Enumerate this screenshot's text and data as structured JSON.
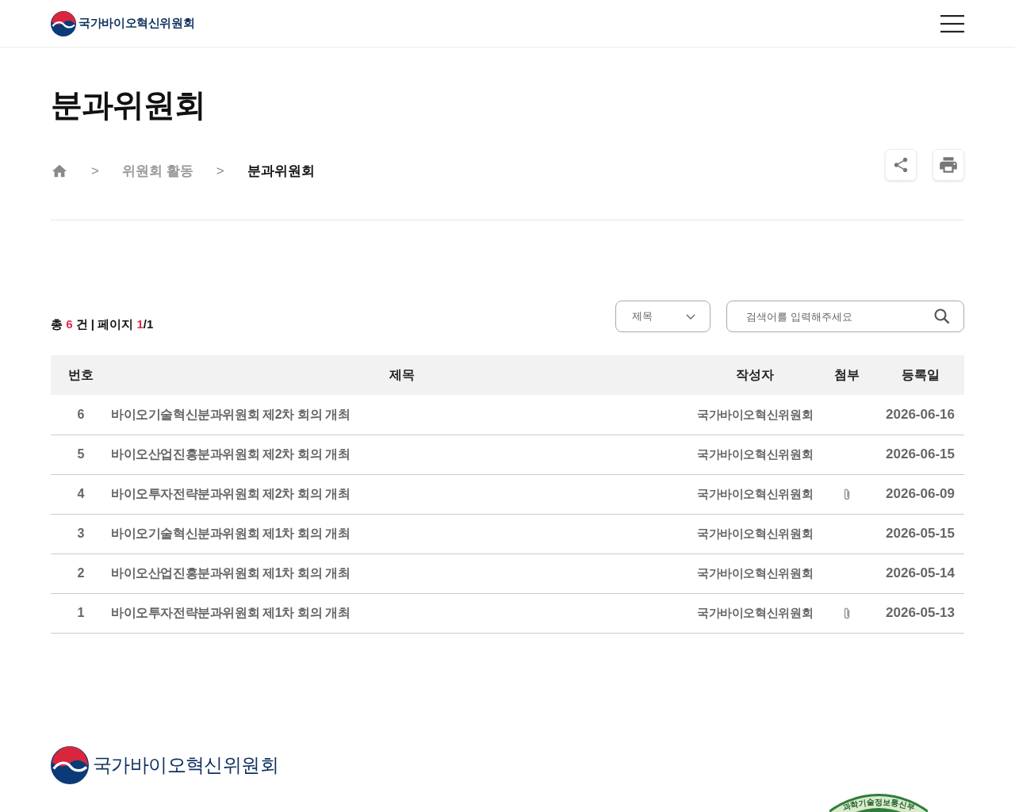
{
  "header": {
    "logo_text": "국가바이오혁신위원회"
  },
  "page_title": "분과위원회",
  "breadcrumb": [
    {
      "separator": ">",
      "label": "위원회 활동",
      "current": false
    },
    {
      "separator": ">",
      "label": "분과위원회",
      "current": true
    }
  ],
  "summary": {
    "prefix": "총",
    "count": "6",
    "count_unit": "건",
    "divider": "|",
    "page_label": "페이지",
    "current_page": "1",
    "page_suffix": "/1"
  },
  "search": {
    "category": "제목",
    "placeholder": "검색어를 입력해주세요"
  },
  "table": {
    "columns": [
      "번호",
      "제목",
      "작성자",
      "첨부",
      "등록일"
    ],
    "rows": [
      {
        "number": "6",
        "title": "바이오기술혁신분과위원회 제2차 회의 개최",
        "author": "국가바이오혁신위원회",
        "attachment": false,
        "date": "2026-06-16"
      },
      {
        "number": "5",
        "title": "바이오산업진흥분과위원회 제2차 회의 개최",
        "author": "국가바이오혁신위원회",
        "attachment": false,
        "date": "2026-06-15"
      },
      {
        "number": "4",
        "title": "바이오투자전략분과위원회 제2차 회의 개최",
        "author": "국가바이오혁신위원회",
        "attachment": true,
        "date": "2026-06-09"
      },
      {
        "number": "3",
        "title": "바이오기술혁신분과위원회 제1차 회의 개최",
        "author": "국가바이오혁신위원회",
        "attachment": false,
        "date": "2026-05-15"
      },
      {
        "number": "2",
        "title": "바이오산업진흥분과위원회 제1차 회의 개최",
        "author": "국가바이오혁신위원회",
        "attachment": false,
        "date": "2026-05-14"
      },
      {
        "number": "1",
        "title": "바이오투자전략분과위원회 제1차 회의 개최",
        "author": "국가바이오혁신위원회",
        "attachment": true,
        "date": "2026-05-13"
      }
    ]
  },
  "footer": {
    "logo_text": "국가바이오혁신위원회",
    "seal_text": "과학기술정보통신부"
  }
}
